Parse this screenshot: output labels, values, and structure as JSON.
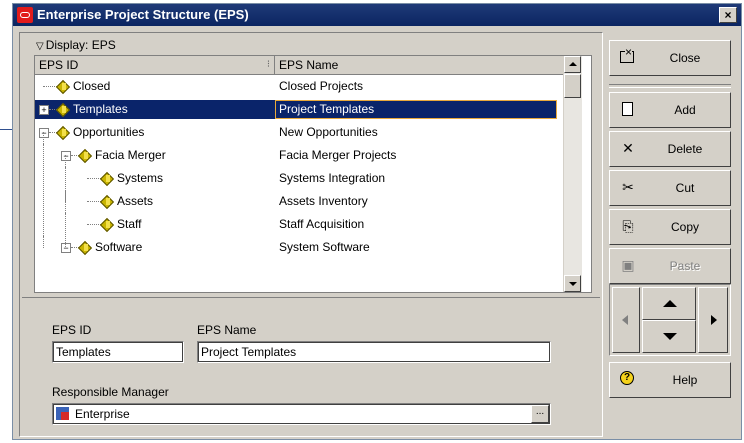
{
  "window": {
    "title": "Enterprise Project Structure (EPS)",
    "close_glyph": "×"
  },
  "display": {
    "label": "Display: EPS",
    "chevron": "▽"
  },
  "columns": {
    "eps_id": "EPS ID",
    "eps_name": "EPS Name"
  },
  "rows": [
    {
      "id": "Closed",
      "name": "Closed Projects",
      "level": 1,
      "expander": "",
      "selected": false
    },
    {
      "id": "Templates",
      "name": "Project Templates",
      "level": 1,
      "expander": "+",
      "selected": true
    },
    {
      "id": "Opportunities",
      "name": "New Opportunities",
      "level": 1,
      "expander": "−",
      "selected": false
    },
    {
      "id": "Facia Merger",
      "name": "Facia Merger Projects",
      "level": 2,
      "expander": "−",
      "selected": false
    },
    {
      "id": "Systems",
      "name": "Systems Integration",
      "level": 3,
      "expander": "",
      "selected": false
    },
    {
      "id": "Assets",
      "name": "Assets Inventory",
      "level": 3,
      "expander": "",
      "selected": false
    },
    {
      "id": "Staff",
      "name": "Staff Acquisition",
      "level": 3,
      "expander": "",
      "selected": false
    },
    {
      "id": "Software",
      "name": "System Software",
      "level": 2,
      "expander": "−",
      "selected": false
    }
  ],
  "form": {
    "eps_id_label": "EPS ID",
    "eps_id_value": "Templates",
    "eps_name_label": "EPS Name",
    "eps_name_value": "Project Templates",
    "manager_label": "Responsible Manager",
    "manager_value": "Enterprise",
    "browse_label": "..."
  },
  "buttons": {
    "close": "Close",
    "add": "Add",
    "delete": "Delete",
    "cut": "Cut",
    "copy": "Copy",
    "paste": "Paste",
    "help": "Help"
  },
  "icons": {
    "delete": "✕",
    "cut": "✂",
    "copy": "⎘",
    "paste": "▣",
    "help": "?",
    "expand": "+",
    "collapse": "−"
  },
  "colors": {
    "title_bar": "#0b2561",
    "selection": "#0a246a",
    "selection_border": "#e8a93b",
    "face": "#d4d0c8"
  }
}
